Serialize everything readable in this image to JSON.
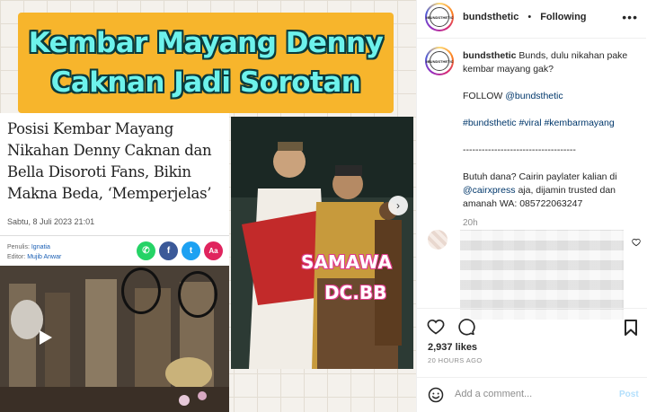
{
  "media": {
    "headline_lines": [
      "Kembar Mayang Denny",
      "Caknan Jadi Sorotan"
    ],
    "article": {
      "title": "Posisi Kembar Mayang Nikahan Denny Caknan dan Bella Disoroti Fans, Bikin Makna Beda, ‘Memperjelas’",
      "date": "Sabtu, 8 Juli 2023 21:01",
      "writer_label": "Penulis:",
      "writer": "Ignatia",
      "editor_label": "Editor:",
      "editor": "Mujib Anwar",
      "share_buttons": [
        "whatsapp-icon",
        "facebook-icon",
        "twitter-icon",
        "font-size-icon"
      ]
    },
    "video_overlay": [
      "SAMAWA",
      "DC.BB"
    ]
  },
  "post": {
    "username": "bundsthetic",
    "separator": "•",
    "follow_label": "Following",
    "avatar_text": "#BUNDSTHETIC",
    "caption": {
      "username": "bundsthetic",
      "text": "Bunds, dulu nikahan pake kembar mayang gak?",
      "follow_prefix": "FOLLOW",
      "follow_handle": "@bundsthetic",
      "hashtags": "#bundsthetic #viral #kembarmayang",
      "divider": "------------------------------------",
      "promo_prefix": "Butuh dana? Cairin paylater kalian di",
      "promo_handle": "@cairxpress",
      "promo_suffix": "aja, dijamin trusted dan amanah WA: 085722063247",
      "time": "20h"
    },
    "likes": "2,937 likes",
    "posted": "20 HOURS AGO",
    "add_comment_placeholder": "Add a comment...",
    "post_label": "Post"
  },
  "colors": {
    "headline_bg": "#f7b52c",
    "headline_text": "#6df2ec",
    "link": "#00376b",
    "post_disabled": "#b2dffc"
  }
}
